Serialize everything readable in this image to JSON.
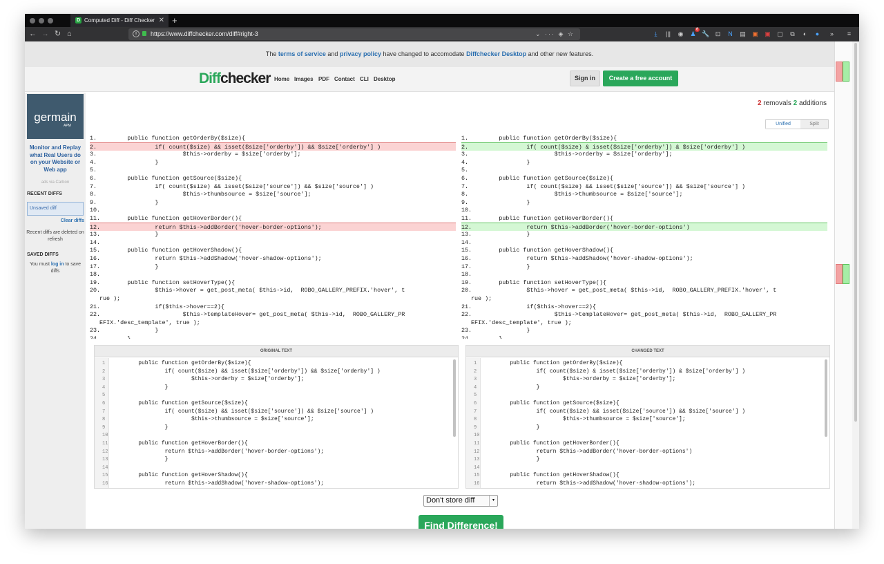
{
  "browser": {
    "tab_title": "Computed Diff - Diff Checker",
    "favicon_letter": "D",
    "url": "https://www.diffchecker.com/diff#right-3",
    "badge": "6"
  },
  "notice": {
    "pre": "The ",
    "tos": "terms of service",
    "and": " and ",
    "privacy": "privacy policy",
    "mid": " have changed to accomodate ",
    "desktop": "Diffchecker Desktop",
    "post": " and other new features."
  },
  "header": {
    "logo_diff": "Diff",
    "logo_checker": "checker",
    "nav": [
      "Home",
      "Images",
      "PDF",
      "Contact",
      "CLI",
      "Desktop"
    ],
    "signin": "Sign in",
    "create": "Create a free account"
  },
  "sidebar": {
    "ad_brand": "germain",
    "ad_sub": "APM",
    "ad_text": "Monitor and Replay what Real Users do on your Website or Web app",
    "ads_via": "ads via Carbon",
    "recent_title": "RECENT DIFFS",
    "unsaved": "Unsaved diff",
    "clear": "Clear diffs",
    "recent_note": "Recent diffs are deleted on refresh",
    "saved_title": "SAVED DIFFS",
    "saved_pre": "You must ",
    "saved_link": "log in",
    "saved_post": " to save diffs"
  },
  "summary": {
    "removals_count": "2",
    "removals_label": " removals ",
    "additions_count": "2",
    "additions_label": " additions"
  },
  "view": {
    "unified": "Unified",
    "split": "Split"
  },
  "diff": {
    "left": [
      "        public function getOrderBy($size){",
      "                if( count($size) && isset($size['orderby']) && $size['orderby'] )",
      "                        $this->orderby = $size['orderby'];",
      "                }",
      "",
      "        public function getSource($size){",
      "                if( count($size) && isset($size['source']) && $size['source'] )",
      "                        $this->thumbsource = $size['source'];",
      "                }",
      "",
      "        public function getHoverBorder(){",
      "                return $this->addBorder('hover-border-options');",
      "                }",
      "",
      "        public function getHoverShadow(){",
      "                return $this->addShadow('hover-shadow-options');",
      "                }",
      "",
      "        public function setHoverType(){",
      "                $this->hover = get_post_meta( $this->id,  ROBO_GALLERY_PREFIX.'hover', t",
      "rue );",
      "                if($this->hover==2){",
      "                        $this->templateHover= get_post_meta( $this->id,  ROBO_GALLERY_PR",
      "EFIX.'desc_template', true );",
      "                }",
      "        }"
    ],
    "right": [
      "        public function getOrderBy($size){",
      "                if( count($size) & isset($size['orderby']) & $size['orderby'] )",
      "                        $this->orderby = $size['orderby'];",
      "                }",
      "",
      "        public function getSource($size){",
      "                if( count($size) && isset($size['source']) && $size['source'] )",
      "                        $this->thumbsource = $size['source'];",
      "                }",
      "",
      "        public function getHoverBorder(){",
      "                return $this->addBorder('hover-border-options')",
      "                }",
      "",
      "        public function getHoverShadow(){",
      "                return $this->addShadow('hover-shadow-options');",
      "                }",
      "",
      "        public function setHoverType(){",
      "                $this->hover = get_post_meta( $this->id,  ROBO_GALLERY_PREFIX.'hover', t",
      "rue );",
      "                if($this->hover==2){",
      "                        $this->templateHover= get_post_meta( $this->id,  ROBO_GALLERY_PR",
      "EFIX.'desc_template', true );",
      "                }",
      "        }"
    ],
    "left_numbers": [
      "1.",
      "2.",
      "3.",
      "4.",
      "5.",
      "6.",
      "7.",
      "8.",
      "9.",
      "10.",
      "11.",
      "12.",
      "13.",
      "14.",
      "15.",
      "16.",
      "17.",
      "18.",
      "19.",
      "20.",
      "",
      "21.",
      "22.",
      "",
      "23.",
      "24."
    ],
    "right_numbers": [
      "1.",
      "2.",
      "3.",
      "4.",
      "5.",
      "6.",
      "7.",
      "8.",
      "9.",
      "10.",
      "11.",
      "12.",
      "13.",
      "14.",
      "15.",
      "16.",
      "17.",
      "18.",
      "19.",
      "20.",
      "",
      "21.",
      "22.",
      "",
      "23.",
      "24."
    ],
    "removed_rows": [
      1,
      11
    ],
    "added_rows": [
      1,
      11
    ]
  },
  "editors": {
    "original_title": "ORIGINAL TEXT",
    "changed_title": "CHANGED TEXT",
    "numbers": [
      "1",
      "2",
      "3",
      "4",
      "5",
      "6",
      "7",
      "8",
      "9",
      "10",
      "11",
      "12",
      "13",
      "14",
      "15",
      "16"
    ],
    "original": [
      "        public function getOrderBy($size){",
      "                if( count($size) && isset($size['orderby']) && $size['orderby'] )",
      "                        $this->orderby = $size['orderby'];",
      "                }",
      "",
      "        public function getSource($size){",
      "                if( count($size) && isset($size['source']) && $size['source'] )",
      "                        $this->thumbsource = $size['source'];",
      "                }",
      "",
      "        public function getHoverBorder(){",
      "                return $this->addBorder('hover-border-options');",
      "                }",
      "",
      "        public function getHoverShadow(){",
      "                return $this->addShadow('hover-shadow-options');"
    ],
    "changed": [
      "        public function getOrderBy($size){",
      "                if( count($size) & isset($size['orderby']) & $size['orderby'] )",
      "                        $this->orderby = $size['orderby'];",
      "                }",
      "",
      "        public function getSource($size){",
      "                if( count($size) && isset($size['source']) && $size['source'] )",
      "                        $this->thumbsource = $size['source'];",
      "                }",
      "",
      "        public function getHoverBorder(){",
      "                return $this->addBorder('hover-border-options')",
      "                }",
      "",
      "        public function getHoverShadow(){",
      "                return $this->addShadow('hover-shadow-options');"
    ]
  },
  "store_select": "Don't store diff",
  "find_button": "Find Difference!",
  "colors": {
    "removed_bg": "#fbd3d3",
    "removed_border": "#e07a7a",
    "removed_highlight": "#f4a3a3",
    "added_bg": "#d4f7d4",
    "added_border": "#5cc45c",
    "added_highlight": "#9ee79e",
    "brand_green": "#2aa75a",
    "link_blue": "#2a6fb0"
  }
}
